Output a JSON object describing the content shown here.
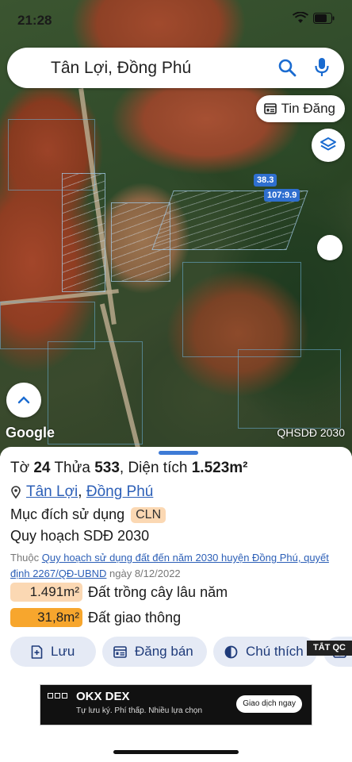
{
  "status_bar": {
    "time": "21:28"
  },
  "search": {
    "query": "Tân Lợi, Đồng Phú"
  },
  "map": {
    "tin_dang_label": "Tin Đăng",
    "markers": [
      "38.3",
      "107:9.9"
    ],
    "google_logo": "Google",
    "layer_code": "QHSDĐ 2030"
  },
  "parcel": {
    "title_prefix": "Tờ",
    "sheet_number": "24",
    "plot_label": "Thửa",
    "plot_number": "533",
    "area_label": ", Diện tích",
    "area_value": "1.523m²",
    "commune": "Tân Lợi",
    "separator": ",",
    "district": "Đồng Phú",
    "purpose_label": "Mục đích sử dụng",
    "purpose_code": "CLN",
    "plan_title": "Quy hoạch SDĐ 2030",
    "plan_note_prefix": "Thuộc",
    "plan_note_link": "Quy hoạch sử dụng đất đến năm 2030 huyện Đồng Phú, quyết định 2267/QĐ-UBND",
    "plan_note_suffix": "ngày 8/12/2022",
    "areas": [
      {
        "value": "1.491m²",
        "label": "Đất trồng cây lâu năm",
        "color": "#fbd8b3"
      },
      {
        "value": "31,8m²",
        "label": "Đất giao thông",
        "color": "#f7a62d"
      }
    ]
  },
  "actions": [
    {
      "label": "Lưu",
      "icon": "save-plus-icon"
    },
    {
      "label": "Đăng bán",
      "icon": "listing-icon"
    },
    {
      "label": "Chú thích",
      "icon": "half-circle-icon"
    },
    {
      "label": "",
      "icon": "camera-plus-icon"
    }
  ],
  "ad": {
    "close_label": "TẮT QC",
    "brand": "OKX DEX",
    "tagline": "Tự lưu ký. Phí thấp. Nhiều lựa chọn",
    "cta": "Giao dịch ngay"
  },
  "colors": {
    "accent": "#2c5fb7",
    "button_bg": "#e5eaf5",
    "handle": "#3e7bd6"
  }
}
